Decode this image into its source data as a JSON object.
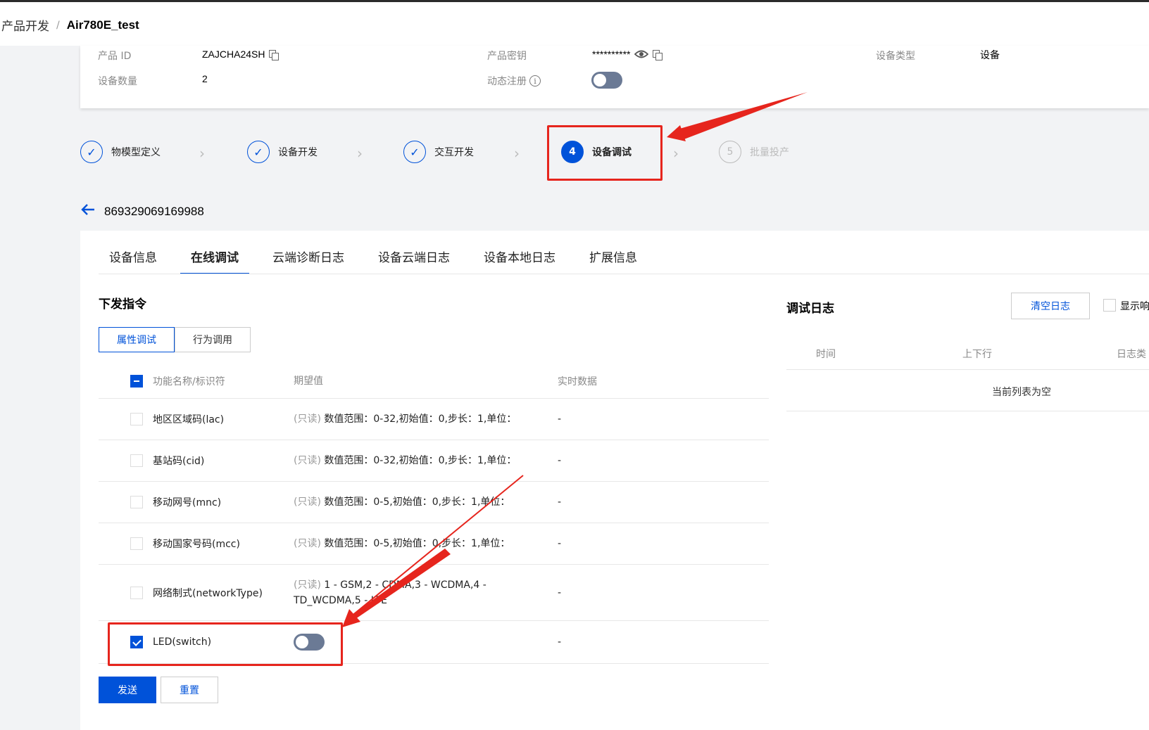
{
  "breadcrumb": {
    "parent": "产品开发",
    "sep": "/",
    "current": "Air780E_test"
  },
  "product_info": {
    "product_id_label": "产品 ID",
    "product_id": "ZAJCHA24SH",
    "device_count_label": "设备数量",
    "device_count": "2",
    "product_key_label": "产品密钥",
    "product_key": "**********",
    "dynamic_reg_label": "动态注册",
    "dynamic_reg_enabled": false,
    "device_type_label": "设备类型",
    "device_type": "设备"
  },
  "steps": [
    {
      "label": "物模型定义",
      "state": "done"
    },
    {
      "label": "设备开发",
      "state": "done"
    },
    {
      "label": "交互开发",
      "state": "done"
    },
    {
      "num": "4",
      "label": "设备调试",
      "state": "active"
    },
    {
      "num": "5",
      "label": "批量投产",
      "state": "todo"
    }
  ],
  "device": {
    "id": "869329069169988"
  },
  "tabs": [
    {
      "label": "设备信息",
      "active": false
    },
    {
      "label": "在线调试",
      "active": true
    },
    {
      "label": "云端诊断日志",
      "active": false
    },
    {
      "label": "设备云端日志",
      "active": false
    },
    {
      "label": "设备本地日志",
      "active": false
    },
    {
      "label": "扩展信息",
      "active": false
    }
  ],
  "command": {
    "title": "下发指令",
    "segments": [
      {
        "label": "属性调试",
        "active": true
      },
      {
        "label": "行为调用",
        "active": false
      }
    ],
    "columns": {
      "name": "功能名称/标识符",
      "expected": "期望值",
      "realtime": "实时数据"
    },
    "rows": [
      {
        "name": "地区区域码(lac)",
        "ro": "(只读)",
        "desc": " 数值范围：0-32,初始值：0,步长：1,单位：",
        "realtime": "-",
        "checked": false
      },
      {
        "name": "基站码(cid)",
        "ro": "(只读)",
        "desc": " 数值范围：0-32,初始值：0,步长：1,单位：",
        "realtime": "-",
        "checked": false
      },
      {
        "name": "移动网号(mnc)",
        "ro": "(只读)",
        "desc": " 数值范围：0-5,初始值：0,步长：1,单位：",
        "realtime": "-",
        "checked": false
      },
      {
        "name": "移动国家号码(mcc)",
        "ro": "(只读)",
        "desc": " 数值范围：0-5,初始值：0,步长：1,单位：",
        "realtime": "-",
        "checked": false
      },
      {
        "name": "网络制式(networkType)",
        "ro": "(只读)",
        "desc": " 1 - GSM,2 - CDMA,3 - WCDMA,4 -",
        "desc2": "TD_WCDMA,5 - LTE",
        "realtime": "-",
        "checked": false
      },
      {
        "name": "LED(switch)",
        "realtime": "-",
        "checked": true,
        "switch_on": false
      }
    ],
    "send_label": "发送",
    "reset_label": "重置"
  },
  "debug_log": {
    "title": "调试日志",
    "clear_label": "清空日志",
    "show_label": "显示响",
    "columns": {
      "time": "时间",
      "direction": "上下行",
      "type": "日志类"
    },
    "empty_text": "当前列表为空"
  },
  "colors": {
    "primary": "#0052d9",
    "annotation": "#e6251d"
  }
}
